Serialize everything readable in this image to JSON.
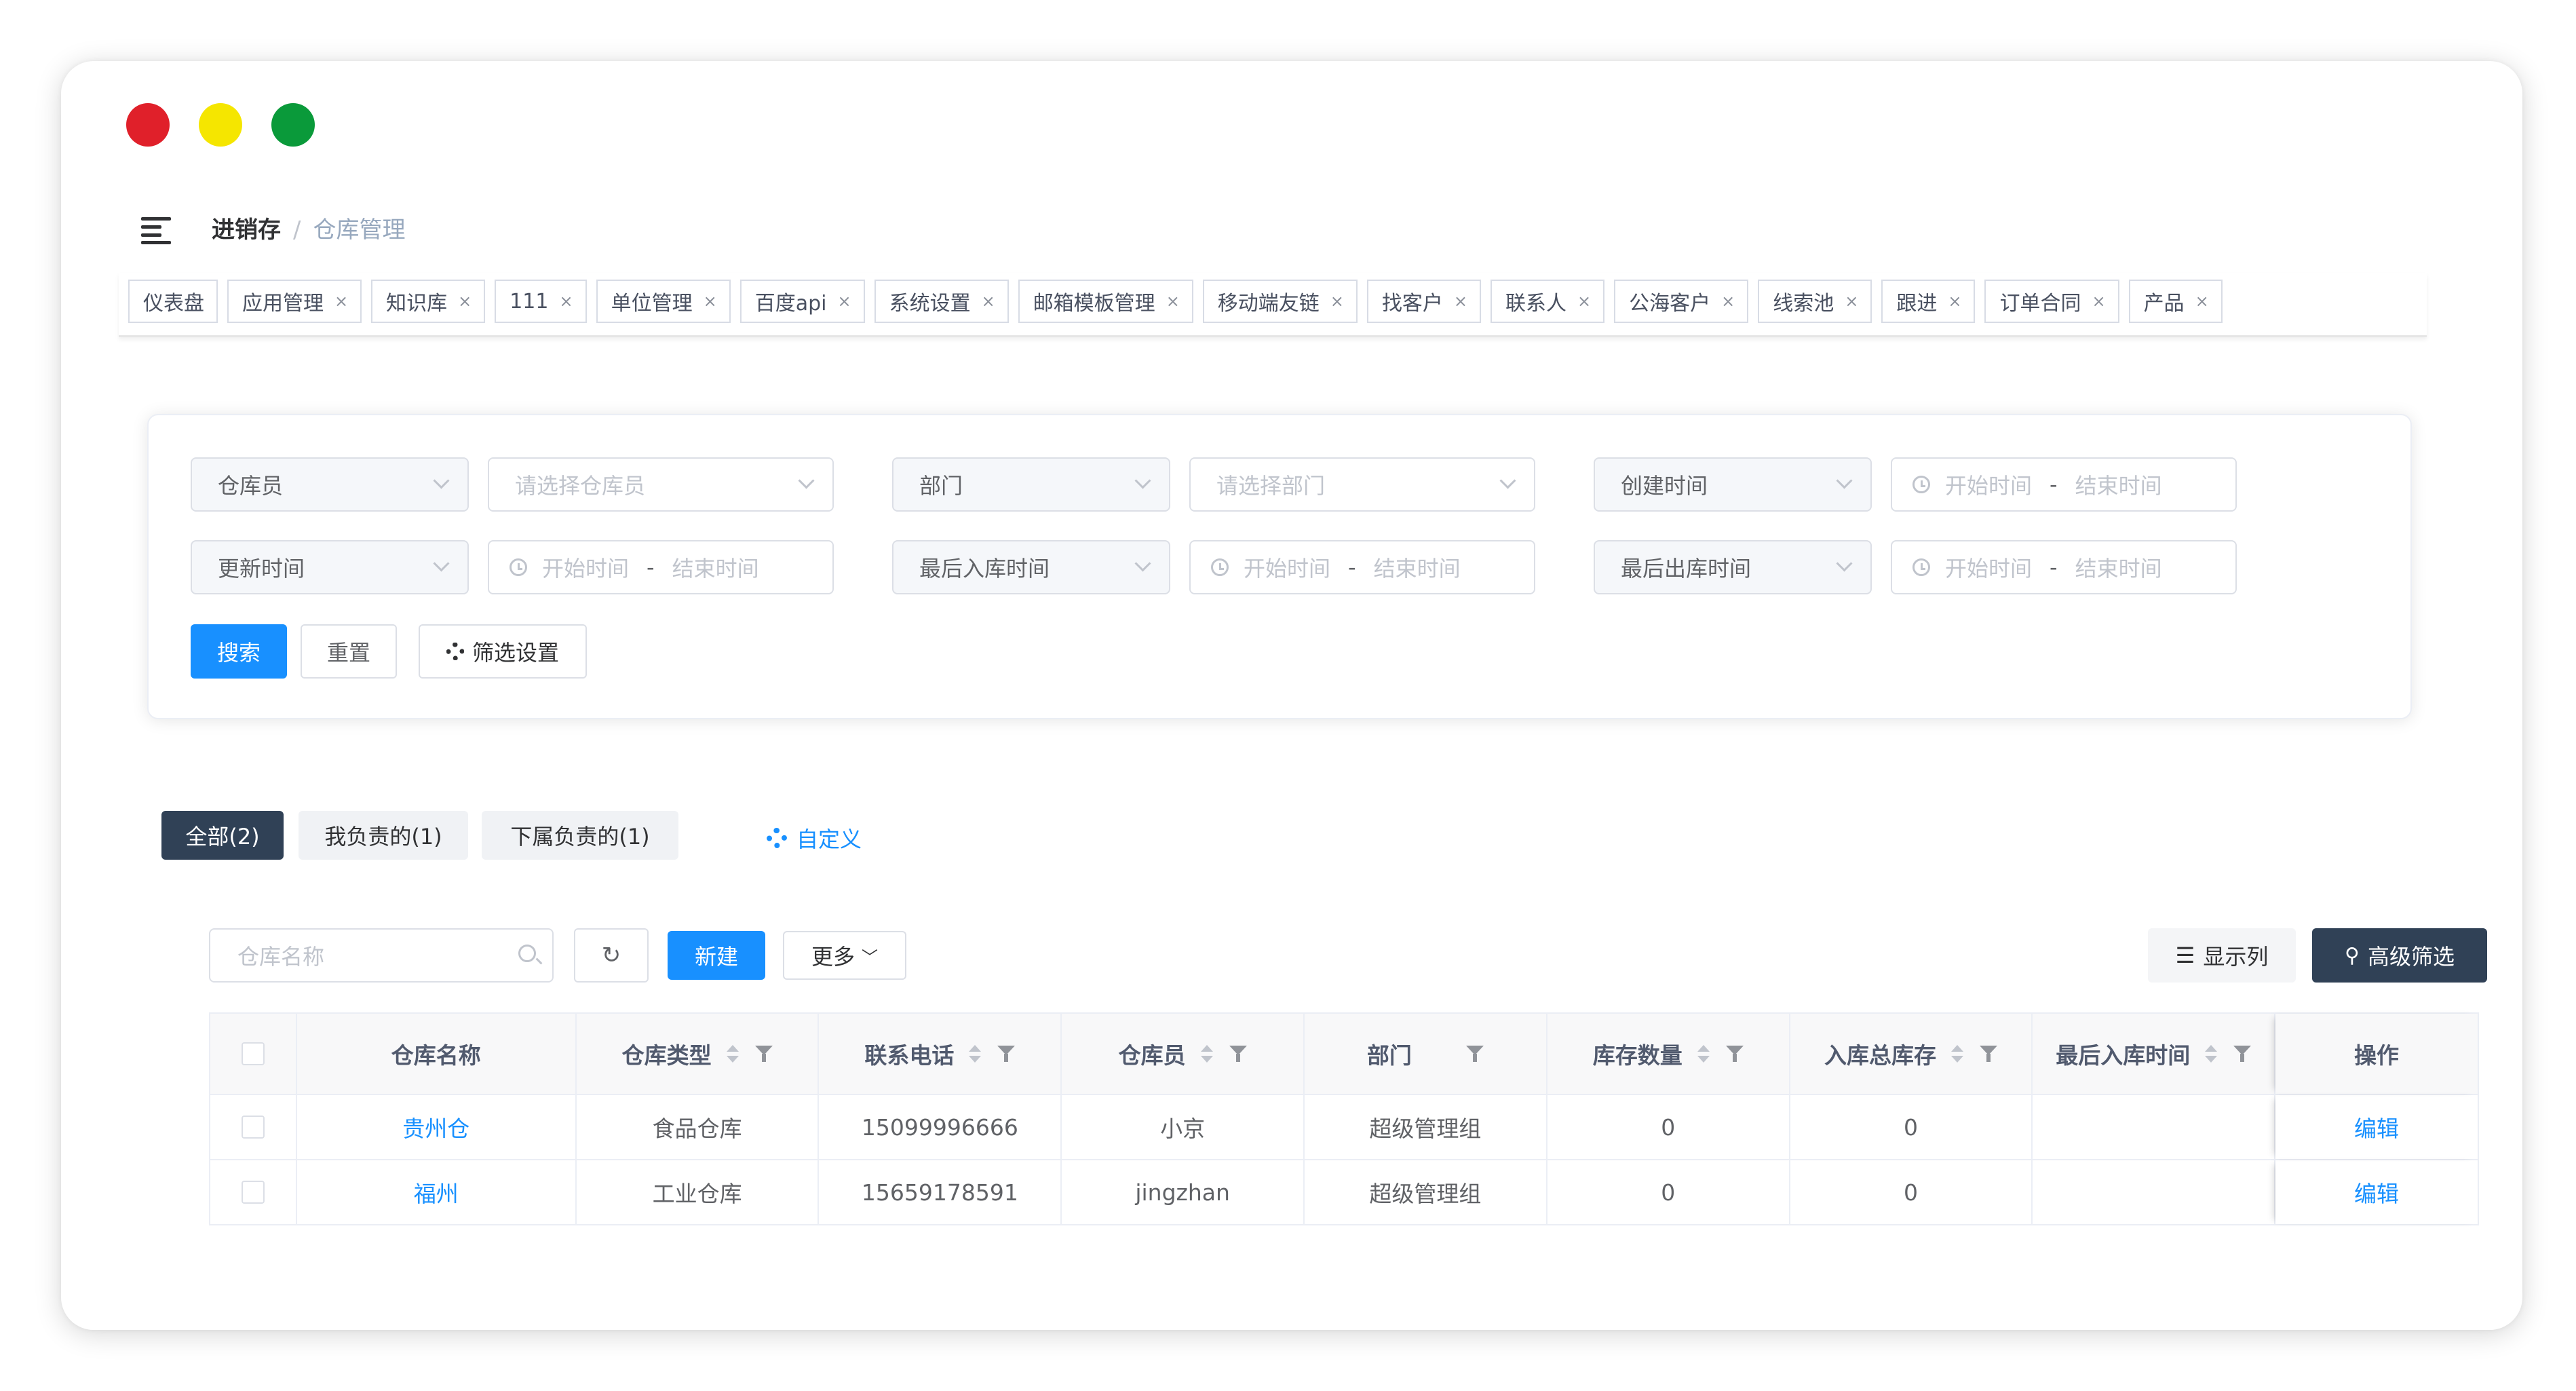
{
  "breadcrumb": {
    "root": "进销存",
    "separator": "/",
    "current": "仓库管理"
  },
  "tags": [
    {
      "label": "仪表盘",
      "closable": false
    },
    {
      "label": "应用管理",
      "closable": true
    },
    {
      "label": "知识库",
      "closable": true
    },
    {
      "label": "111",
      "closable": true
    },
    {
      "label": "单位管理",
      "closable": true
    },
    {
      "label": "百度api",
      "closable": true
    },
    {
      "label": "系统设置",
      "closable": true
    },
    {
      "label": "邮箱模板管理",
      "closable": true
    },
    {
      "label": "移动端友链",
      "closable": true
    },
    {
      "label": "找客户",
      "closable": true
    },
    {
      "label": "联系人",
      "closable": true
    },
    {
      "label": "公海客户",
      "closable": true
    },
    {
      "label": "线索池",
      "closable": true
    },
    {
      "label": "跟进",
      "closable": true
    },
    {
      "label": "订单合同",
      "closable": true
    },
    {
      "label": "产品",
      "closable": true
    }
  ],
  "filters": {
    "row1": {
      "f1_label": "仓库员",
      "f1_placeholder": "请选择仓库员",
      "f2_label": "部门",
      "f2_placeholder": "请选择部门",
      "f3_label": "创建时间",
      "f3_start": "开始时间",
      "f3_sep": "-",
      "f3_end": "结束时间"
    },
    "row2": {
      "f1_label": "更新时间",
      "f1_start": "开始时间",
      "f1_sep": "-",
      "f1_end": "结束时间",
      "f2_label": "最后入库时间",
      "f2_start": "开始时间",
      "f2_sep": "-",
      "f2_end": "结束时间",
      "f3_label": "最后出库时间",
      "f3_start": "开始时间",
      "f3_sep": "-",
      "f3_end": "结束时间"
    },
    "buttons": {
      "search": "搜索",
      "reset": "重置",
      "settings": "筛选设置"
    }
  },
  "scope_tabs": [
    {
      "label": "全部(2)",
      "active": true
    },
    {
      "label": "我负责的(1)",
      "active": false
    },
    {
      "label": "下属负责的(1)",
      "active": false
    }
  ],
  "custom_label": "自定义",
  "toolbar": {
    "search_placeholder": "仓库名称",
    "new_label": "新建",
    "more_label": "更多",
    "columns_label": "显示列",
    "advanced_label": "高级筛选"
  },
  "table": {
    "headers": [
      "仓库名称",
      "仓库类型",
      "联系电话",
      "仓库员",
      "部门",
      "库存数量",
      "入库总库存",
      "最后入库时间",
      "操作"
    ],
    "rows": [
      [
        "贵州仓",
        "食品仓库",
        "15099996666",
        "小京",
        "超级管理组",
        "0",
        "0",
        "",
        "编辑"
      ],
      [
        "福州",
        "工业仓库",
        "15659178591",
        "jingzhan",
        "超级管理组",
        "0",
        "0",
        "",
        "编辑"
      ]
    ]
  },
  "colors": {
    "primary": "#1890ff",
    "dark": "#304156",
    "link": "#1890ff"
  }
}
